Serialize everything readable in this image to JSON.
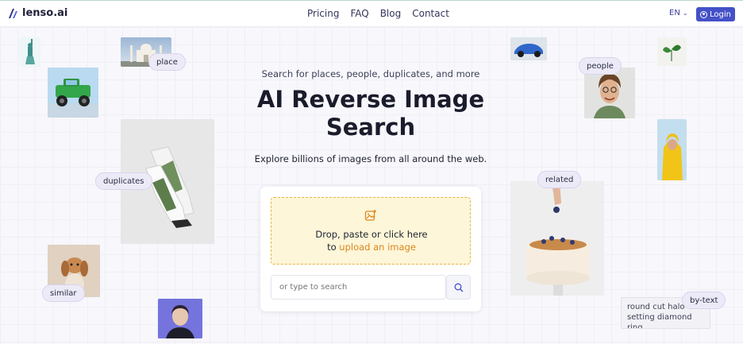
{
  "header": {
    "logo_text": "lenso.ai",
    "nav": [
      "Pricing",
      "FAQ",
      "Blog",
      "Contact"
    ],
    "language": "EN",
    "login_label": "Login"
  },
  "hero": {
    "subtitle": "Search for places, people, duplicates, and more",
    "title": "AI Reverse Image Search",
    "description": "Explore billions of images from all around the web."
  },
  "upload": {
    "drop_line1": "Drop, paste or click here",
    "drop_prefix": "to",
    "drop_link": "upload an image",
    "search_placeholder": "or type to search"
  },
  "tags": {
    "place": "place",
    "duplicates": "duplicates",
    "similar": "similar",
    "people": "people",
    "related": "related",
    "by_text": "by-text"
  },
  "text_snippet": "round cut halo setting diamond ring",
  "colors": {
    "brand": "#4451c7",
    "accent_upload": "#d9871f",
    "dropzone_bg": "#fdf6d8"
  }
}
